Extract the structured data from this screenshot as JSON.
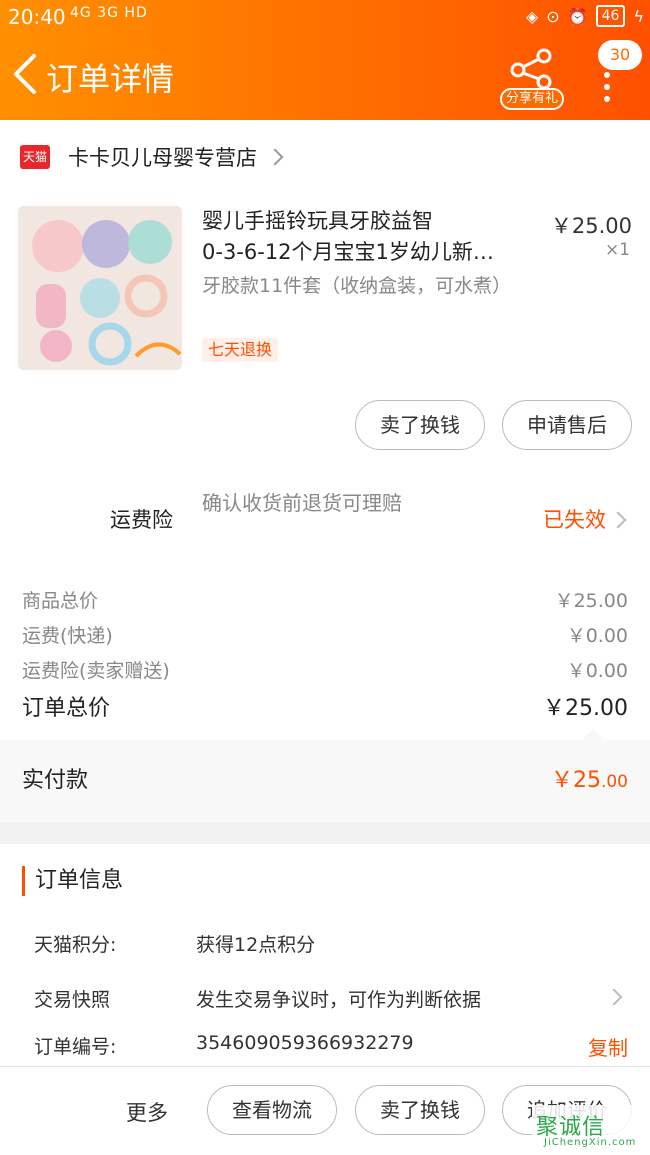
{
  "status_bar": {
    "time": "20:40",
    "signal": "4G 3G HD",
    "battery": "46"
  },
  "header": {
    "title": "订单详情",
    "share_label": "分享有礼",
    "badge_count": "30",
    "colors": {
      "start": "#ff9000",
      "end": "#ff5000"
    }
  },
  "shop": {
    "logo_text": "天猫",
    "name": "卡卡贝儿母婴专营店"
  },
  "product": {
    "title_line1": "婴儿手摇铃玩具牙胶益智",
    "title_line2": "0-3-6-12个月宝宝1岁幼儿新…",
    "price": "￥25.00",
    "quantity": "×1",
    "sku": "牙胶款11件套（收纳盒装，可水煮）",
    "tag": "七天退换"
  },
  "item_actions": {
    "sell": "卖了换钱",
    "after_sale": "申请售后"
  },
  "insurance": {
    "label": "运费险",
    "desc": "确认收货前退货可理赔",
    "status": "已失效"
  },
  "price_rows": [
    {
      "label": "商品总价",
      "value": "￥25.00"
    },
    {
      "label": "运费(快递)",
      "value": "￥0.00"
    },
    {
      "label": "运费险(卖家赠送)",
      "value": "￥0.00"
    }
  ],
  "order_total": {
    "label": "订单总价",
    "value": "￥25.00"
  },
  "paid": {
    "label": "实付款",
    "value_int": "￥25",
    "value_dec": ".00"
  },
  "order_info": {
    "heading": "订单信息",
    "rows": [
      {
        "key": "天猫积分:",
        "value": "获得12点积分"
      },
      {
        "key": "交易快照",
        "value": "发生交易争议时，可作为判断依据"
      },
      {
        "key": "订单编号:",
        "value": "354609059366932279",
        "action": "复制"
      }
    ]
  },
  "bottom_bar": {
    "more": "更多",
    "logistics": "查看物流",
    "sell": "卖了换钱",
    "review": "追加评价"
  },
  "watermark": {
    "text": "聚诚信",
    "domain": "JiChengXin.com"
  },
  "accent_color": "#ff5000"
}
